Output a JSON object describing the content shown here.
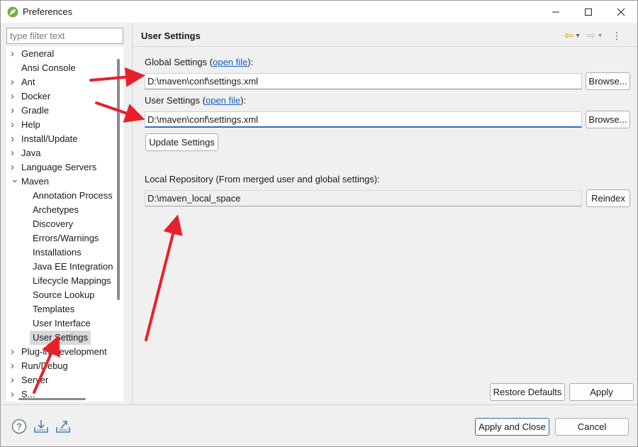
{
  "window": {
    "title": "Preferences",
    "minimize": "—",
    "maximize": "☐",
    "close": "✕"
  },
  "filter": {
    "placeholder": "type filter text",
    "value": ""
  },
  "tree": {
    "items": [
      {
        "label": "General",
        "expandable": true
      },
      {
        "label": "Ansi Console",
        "expandable": false
      },
      {
        "label": "Ant",
        "expandable": true
      },
      {
        "label": "Docker",
        "expandable": true
      },
      {
        "label": "Gradle",
        "expandable": true
      },
      {
        "label": "Help",
        "expandable": true
      },
      {
        "label": "Install/Update",
        "expandable": true
      },
      {
        "label": "Java",
        "expandable": true
      },
      {
        "label": "Language Servers",
        "expandable": true
      },
      {
        "label": "Maven",
        "expandable": true,
        "expanded": true
      },
      {
        "label": "Annotation Process",
        "child": true
      },
      {
        "label": "Archetypes",
        "child": true
      },
      {
        "label": "Discovery",
        "child": true
      },
      {
        "label": "Errors/Warnings",
        "child": true
      },
      {
        "label": "Installations",
        "child": true
      },
      {
        "label": "Java EE Integration",
        "child": true
      },
      {
        "label": "Lifecycle Mappings",
        "child": true
      },
      {
        "label": "Source Lookup",
        "child": true
      },
      {
        "label": "Templates",
        "child": true
      },
      {
        "label": "User Interface",
        "child": true
      },
      {
        "label": "User Settings",
        "child": true,
        "selected": true
      },
      {
        "label": "Plug-in Development",
        "expandable": true
      },
      {
        "label": "Run/Debug",
        "expandable": true
      },
      {
        "label": "Server",
        "expandable": true
      },
      {
        "label": "S...",
        "expandable": true
      }
    ]
  },
  "page": {
    "title": "User Settings",
    "global_settings": {
      "label_prefix": "Global Settings (",
      "link": "open file",
      "label_suffix": "):",
      "value": "D:\\maven\\conf\\settings.xml",
      "browse": "Browse..."
    },
    "user_settings": {
      "label_prefix": "User Settings (",
      "link": "open file",
      "label_suffix": "):",
      "value": "D:\\maven\\conf\\settings.xml",
      "browse": "Browse..."
    },
    "update_settings": "Update Settings",
    "local_repo": {
      "label": "Local Repository (From merged user and global settings):",
      "value": "D:\\maven_local_space",
      "reindex": "Reindex"
    },
    "restore_defaults": "Restore Defaults",
    "apply": "Apply"
  },
  "footer": {
    "apply_and_close": "Apply and Close",
    "cancel": "Cancel"
  },
  "icons": {
    "help": "help-icon",
    "import": "import-icon",
    "export": "export-icon"
  },
  "colors": {
    "link": "#1560c0",
    "annotation": "#e8202a",
    "focus": "#2a6fb8",
    "back_arrow": "#d19a1e"
  }
}
